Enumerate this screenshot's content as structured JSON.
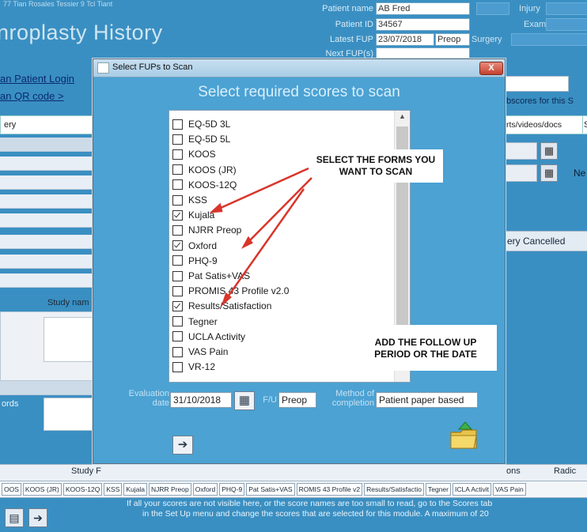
{
  "header": {
    "app_title": "nroplasty History",
    "top_strip": "77 Tian Rosales Tessier 9 Tcl Tiant",
    "patient_name_label": "Patient name",
    "patient_name": "AB Fred",
    "patient_id_label": "Patient ID",
    "patient_id": "34567",
    "latest_fup_label": "Latest FUP",
    "latest_fup": "23/07/2018",
    "latest_fup_type": "Preop",
    "next_fup_label": "Next FUP(s)",
    "injury_label": "Injury",
    "exam_label": "Exam",
    "surgery_label": "Surgery"
  },
  "links": {
    "patient_login": "an Patient Login",
    "qr_code": "an QR code >"
  },
  "tabs": {
    "left": "ery",
    "right_reports": "rts/videos/docs",
    "right_s": "S",
    "subscores": "bscores for this S"
  },
  "right_panel": {
    "ne_label": "Ne",
    "cancelled_label": "ery Cancelled"
  },
  "left_panel": {
    "study_name_label": "Study nam",
    "words_label": "ords"
  },
  "footer": {
    "study_label": "Study F",
    "ons_label": "ons",
    "radio_label": "Radic",
    "chips": [
      "OOS",
      "KOOS (JR)",
      "KOOS-12Q",
      "KSS",
      "Kujala",
      "NJRR Preop",
      "Oxford",
      "PHQ-9",
      "Pat Satis+VAS",
      "ROMIS 43 Profile v2",
      "Results/Satisfactio",
      "Tegner",
      "ICLA Activit",
      "VAS Pain"
    ],
    "note_line1": "If all your scores are not visible here, or the score names are too small to read, go to the Scores tab",
    "note_line2": "in the Set Up menu and change the scores that are selected for this module. A maximum of 20"
  },
  "dialog": {
    "title": "Select FUPs to Scan",
    "close_label": "X",
    "heading": "Select required scores to scan",
    "scores": [
      {
        "label": "EQ-5D 3L",
        "checked": false
      },
      {
        "label": "EQ-5D 5L",
        "checked": false
      },
      {
        "label": "KOOS",
        "checked": false
      },
      {
        "label": "KOOS (JR)",
        "checked": false
      },
      {
        "label": "KOOS-12Q",
        "checked": false
      },
      {
        "label": "KSS",
        "checked": false
      },
      {
        "label": "Kujala",
        "checked": true
      },
      {
        "label": "NJRR Preop",
        "checked": false
      },
      {
        "label": "Oxford",
        "checked": true
      },
      {
        "label": "PHQ-9",
        "checked": false
      },
      {
        "label": "Pat Satis+VAS",
        "checked": false
      },
      {
        "label": "PROMIS 43 Profile v2.0",
        "checked": false
      },
      {
        "label": "Results/Satisfaction",
        "checked": true
      },
      {
        "label": "Tegner",
        "checked": false
      },
      {
        "label": "UCLA Activity",
        "checked": false
      },
      {
        "label": "VAS Pain",
        "checked": false
      },
      {
        "label": "VR-12",
        "checked": false
      }
    ],
    "callout_forms": "SELECT THE FORMS YOU WANT TO SCAN",
    "callout_followup": "ADD THE FOLLOW UP PERIOD OR THE DATE",
    "evaluation_date_label": "Evaluation date",
    "evaluation_date": "31/10/2018",
    "fu_label": "F/U",
    "fu_value": "Preop",
    "method_label": "Method of completion",
    "method_value": "Patient paper based"
  },
  "colors": {
    "app_background": "#3a8fc2",
    "dialog_background": "#4ba2d3",
    "annotation_arrow": "#d9352b"
  },
  "icons": [
    "calendar-icon",
    "scan-arrow-icon",
    "folder-icon",
    "close-icon",
    "scroll-up-icon"
  ]
}
